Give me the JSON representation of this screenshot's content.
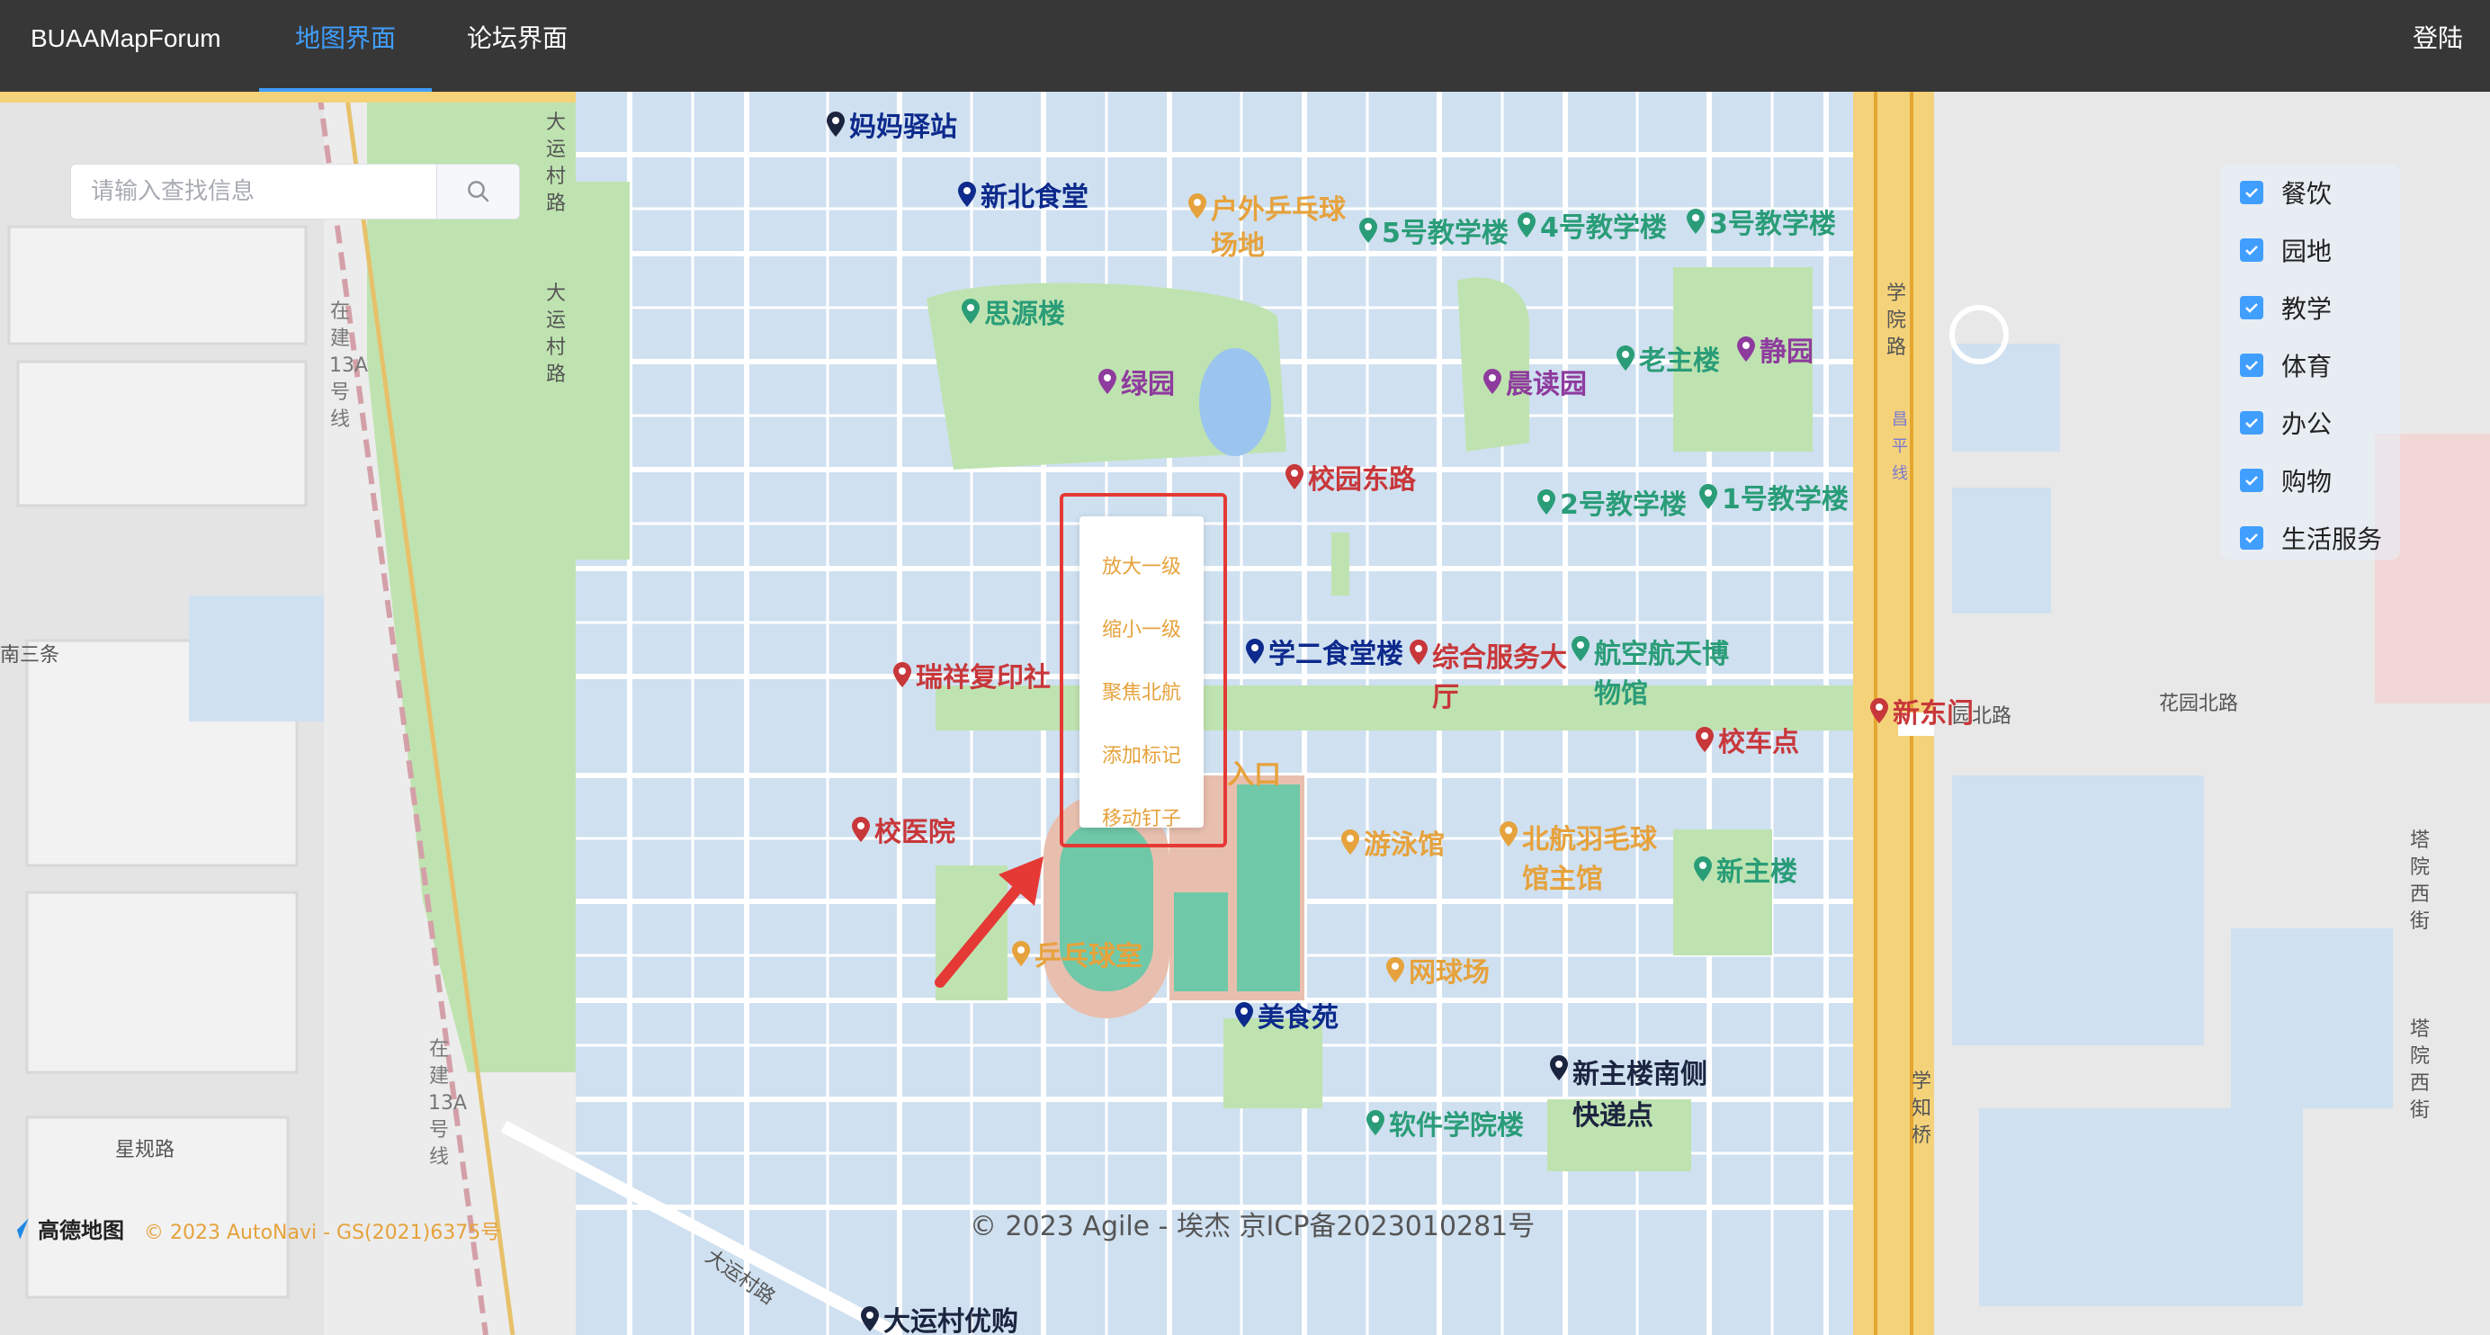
{
  "nav": {
    "brand": "BUAAMapForum",
    "tab_map": "地图界面",
    "tab_forum": "论坛界面",
    "login": "登陆",
    "active_color": "#409eff"
  },
  "search": {
    "placeholder": "请输入查找信息",
    "icon": "search-icon"
  },
  "categories": [
    {
      "label": "餐饮",
      "checked": true
    },
    {
      "label": "园地",
      "checked": true
    },
    {
      "label": "教学",
      "checked": true
    },
    {
      "label": "体育",
      "checked": true
    },
    {
      "label": "办公",
      "checked": true
    },
    {
      "label": "购物",
      "checked": true
    },
    {
      "label": "生活服务",
      "checked": true
    }
  ],
  "context_menu": [
    "放大一级",
    "缩小一级",
    "聚焦北航",
    "添加标记",
    "移动钉子"
  ],
  "pois": {
    "mama": "妈妈驿站",
    "xinbei": "新北食堂",
    "pingpang_out": "户外乒乓球场地",
    "jx5": "5号教学楼",
    "jx4": "4号教学楼",
    "jx3": "3号教学楼",
    "siyuan": "思源楼",
    "lvyuan": "绿园",
    "chendu": "晨读园",
    "laozhu": "老主楼",
    "jingyuan": "静园",
    "xiaoyuandong": "校园东路",
    "jx2": "2号教学楼",
    "jx1": "1号教学楼",
    "ruixiang": "瑞祥复印社",
    "xueer": "学二食堂楼",
    "zonghe": "综合服务大厅",
    "hangkong": "航空航天博物馆",
    "xindongmen": "新东门",
    "xiaoche": "校车点",
    "rukou": "入口",
    "xiaoyiyuan": "校医院",
    "youyong": "游泳馆",
    "yumao": "北航羽毛球馆主馆",
    "xinzhu": "新主楼",
    "pingpang": "乒乓球室",
    "wangqiu": "网球场",
    "meishi": "美食苑",
    "xinzhunan": "新主楼南侧快递点",
    "ruanjian": "软件学院楼",
    "dayun": "大运村优购"
  },
  "roads": {
    "dayuncun1": "大运村路",
    "dayuncun2": "大运村路",
    "zaijian": "在建13A号线",
    "zaijian2": "在建13A号线",
    "nansan": "南三条",
    "xueyuan": "学院路",
    "changping": "昌平线",
    "huayuanbei": "花园北路",
    "yuanbei": "园北路",
    "xinggui": "星规路",
    "tayuan1": "塔院西街",
    "tayuan2": "塔院西街",
    "xuezhi": "学知桥",
    "dayunbottom": "大运村路"
  },
  "footer": {
    "copyright": "© 2023 Agile - 埃杰 京ICP备2023010281号",
    "amap_logo": "高德地图",
    "amap_copy": "© 2023 AutoNavi - GS(2021)6375号"
  },
  "colors": {
    "canteen": "#0d2a8c",
    "teaching": "#2a9d78",
    "garden": "#8e3b9e",
    "office": "#c8373a",
    "sport": "#e6a23c",
    "life": "#1c2540",
    "highlight": "#e53935"
  }
}
